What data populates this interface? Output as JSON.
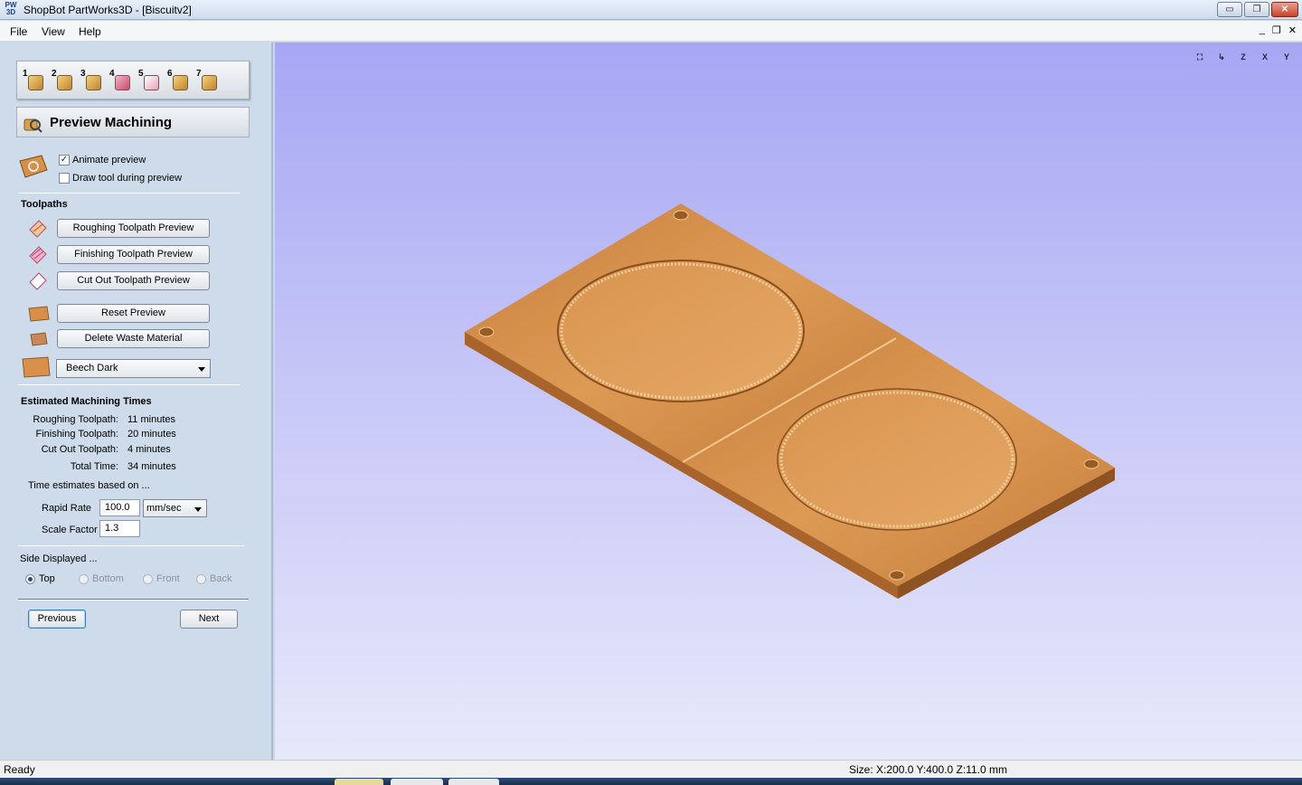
{
  "window": {
    "app_icon_label": "PW 3D",
    "title": "ShopBot PartWorks3D - [Biscuitv2]",
    "minimize": "▭",
    "restore": "❐",
    "close": "✕"
  },
  "menu": {
    "file": "File",
    "view": "View",
    "help": "Help",
    "mdi_minimize": "_",
    "mdi_restore": "❐",
    "mdi_close": "✕"
  },
  "steps": [
    "1",
    "2",
    "3",
    "4",
    "5",
    "6",
    "7"
  ],
  "header": {
    "step": "6",
    "title": "Preview Machining"
  },
  "options": {
    "animate_preview": {
      "label": "Animate preview",
      "checked": true
    },
    "draw_tool": {
      "label": "Draw tool during preview",
      "checked": false
    }
  },
  "toolpaths": {
    "title": "Toolpaths",
    "roughing": "Roughing Toolpath Preview",
    "finishing": "Finishing Toolpath Preview",
    "cutout": "Cut Out Toolpath Preview",
    "reset": "Reset Preview",
    "delete_waste": "Delete Waste Material",
    "material": "Beech Dark"
  },
  "times": {
    "title": "Estimated Machining Times",
    "rows": [
      {
        "label": "Roughing Toolpath:",
        "value": "11 minutes"
      },
      {
        "label": "Finishing Toolpath:",
        "value": "20 minutes"
      },
      {
        "label": "Cut Out Toolpath:",
        "value": "4 minutes"
      },
      {
        "label": "Total Time:",
        "value": "34 minutes"
      }
    ],
    "based_on": "Time estimates based on ...",
    "rapid_rate_label": "Rapid Rate",
    "rapid_rate_value": "100.0",
    "rapid_rate_unit": "mm/sec",
    "scale_factor_label": "Scale Factor",
    "scale_factor_value": "1.3"
  },
  "side": {
    "title": "Side Displayed ...",
    "options": [
      {
        "label": "Top",
        "checked": true,
        "enabled": true
      },
      {
        "label": "Bottom",
        "checked": false,
        "enabled": false
      },
      {
        "label": "Front",
        "checked": false,
        "enabled": false
      },
      {
        "label": "Back",
        "checked": false,
        "enabled": false
      }
    ]
  },
  "nav": {
    "previous": "Previous",
    "next": "Next"
  },
  "view_icons": [
    "fit-view",
    "iso-view",
    "z-view",
    "x-view",
    "y-view"
  ],
  "status": {
    "left": "Ready",
    "right": "Size: X:200.0 Y:400.0 Z:11.0 mm"
  },
  "colors": {
    "wood_light": "#e0a35d",
    "wood_dark": "#b8702f",
    "viewport_top": "#a6a6f4",
    "viewport_bottom": "#e8e8fb",
    "panel_bg": "#cddbea"
  }
}
